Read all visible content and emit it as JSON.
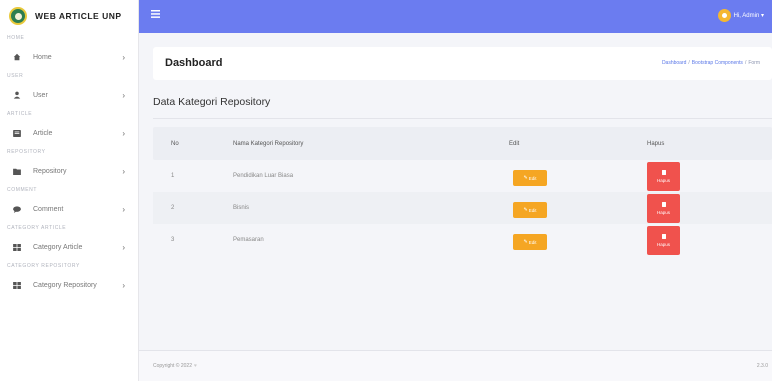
{
  "brand": {
    "title": "WEB ARTICLE UNP"
  },
  "sidebar": {
    "sections": [
      {
        "heading": "HOME",
        "item": {
          "label": "Home",
          "icon": "home-icon"
        }
      },
      {
        "heading": "USER",
        "item": {
          "label": "User",
          "icon": "user-icon"
        }
      },
      {
        "heading": "ARTICLE",
        "item": {
          "label": "Article",
          "icon": "article-icon"
        }
      },
      {
        "heading": "REPOSITORY",
        "item": {
          "label": "Repository",
          "icon": "folder-icon"
        }
      },
      {
        "heading": "COMMENT",
        "item": {
          "label": "Comment",
          "icon": "comment-icon"
        }
      },
      {
        "heading": "CATEGORY ARTICLE",
        "item": {
          "label": "Category Article",
          "icon": "grid-icon"
        }
      },
      {
        "heading": "CATEGORY REPOSITORY",
        "item": {
          "label": "Category Repository",
          "icon": "grid-icon"
        }
      }
    ]
  },
  "topbar": {
    "user_label": "Hi, Admin ▾",
    "accent": "#6b7cf0"
  },
  "header": {
    "title": "Dashboard",
    "breadcrumb": [
      "Dashboard",
      "Bootstrap Components",
      "Form"
    ]
  },
  "content": {
    "title": "Data Kategori Repository",
    "table": {
      "headers": [
        "No",
        "Nama Kategori Repository",
        "Edit",
        "Hapus"
      ],
      "rows": [
        {
          "no": "1",
          "name": "Pendidikan Luar Biasa"
        },
        {
          "no": "2",
          "name": "Bisnis"
        },
        {
          "no": "3",
          "name": "Pemasaran"
        }
      ],
      "edit_label": "Edit",
      "delete_label": "Hapus"
    }
  },
  "footer": {
    "copyright": "Copyright © 2022",
    "version": "2.3.0"
  },
  "colors": {
    "edit": "#f5a623",
    "delete": "#f0524d"
  }
}
